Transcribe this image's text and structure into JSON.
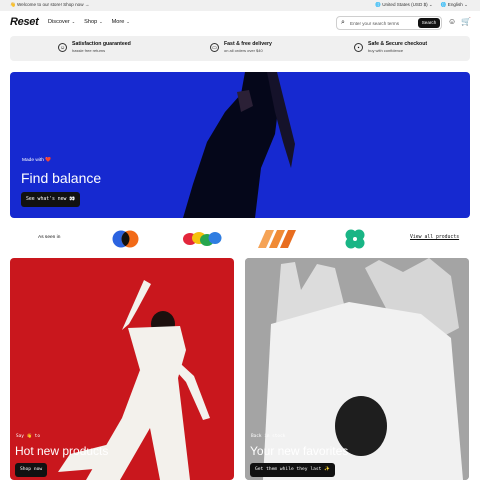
{
  "announcement": {
    "message": "👋 Welcome to our store! Shop now →",
    "country": "🌐 United States (USD $) ⌄",
    "language": "🌐 English ⌄"
  },
  "nav": {
    "logo": "Reset",
    "menu": [
      {
        "label": "Discover"
      },
      {
        "label": "Shop"
      },
      {
        "label": "More"
      }
    ],
    "search_placeholder": "Enter your search terms",
    "search_button": "Search"
  },
  "benefits": [
    {
      "title": "Satisfaction guaranteed",
      "subtitle": "hassle free returns",
      "icon": "smile-icon"
    },
    {
      "title": "Fast & free delivery",
      "subtitle": "on all orders over $40",
      "icon": "truck-icon"
    },
    {
      "title": "Safe & Secure checkout",
      "subtitle": "buy with confidence",
      "icon": "lock-icon"
    }
  ],
  "hero": {
    "eyebrow": "Made with ❤️",
    "title": "Find balance",
    "button": "See what's new 👀",
    "bg_color": "#1629d0"
  },
  "seen_in": {
    "label": "As seen in",
    "view_all": "View all products"
  },
  "cards": [
    {
      "eyebrow": "Say 👋 to",
      "title": "Hot new products",
      "button": "Shop now",
      "bg_color": "#c9171d"
    },
    {
      "eyebrow": "Back in stock",
      "title": "Your new favorites",
      "button": "Get them while they last ✨",
      "bg_color": "#9c9c9c"
    }
  ]
}
